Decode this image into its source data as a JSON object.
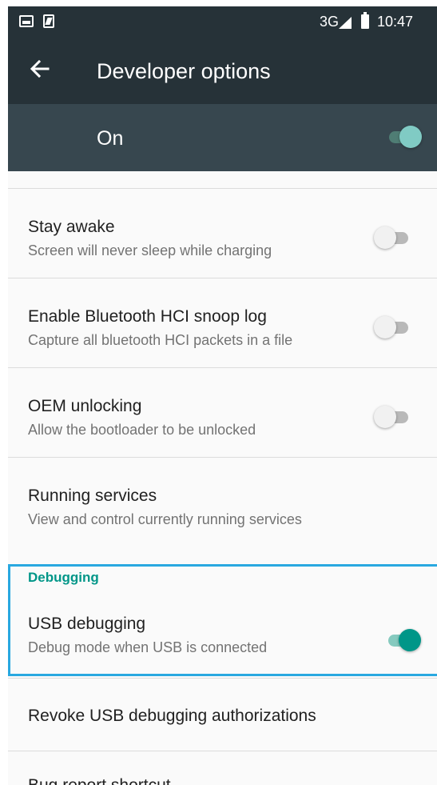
{
  "status_bar": {
    "left_icons": [
      "image-notification-icon",
      "sim-card-icon"
    ],
    "network": "3G",
    "time": "10:47"
  },
  "toolbar": {
    "title": "Developer options",
    "back_icon": "arrow-back-icon"
  },
  "master_switch": {
    "label": "On",
    "checked": true
  },
  "items": [
    {
      "title": "Stay awake",
      "summary": "Screen will never sleep while charging",
      "toggle": false
    },
    {
      "title": "Enable Bluetooth HCI snoop log",
      "summary": "Capture all bluetooth HCI packets in a file",
      "toggle": false
    },
    {
      "title": "OEM unlocking",
      "summary": "Allow the bootloader to be unlocked",
      "toggle": false
    },
    {
      "title": "Running services",
      "summary": "View and control currently running services"
    }
  ],
  "debugging": {
    "category": "Debugging",
    "usb": {
      "title": "USB debugging",
      "summary": "Debug mode when USB is connected",
      "toggle": true
    },
    "revoke": {
      "title": "Revoke USB debugging authorizations"
    },
    "bug_report": {
      "title": "Bug report shortcut"
    }
  },
  "colors": {
    "toolbar": "#263238",
    "switchbar": "#37474f",
    "accent": "#009688",
    "highlight": "#29a8e0"
  }
}
